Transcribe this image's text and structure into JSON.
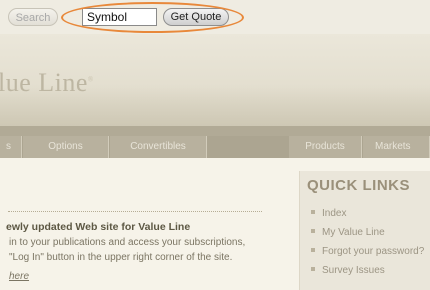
{
  "topbar": {
    "search_label": "Search",
    "symbol_value": "Symbol",
    "get_quote_label": "Get Quote"
  },
  "header": {
    "logo_text": "lue Line",
    "logo_mark": "®"
  },
  "tabs": {
    "first_label": "s",
    "options_label": "Options",
    "convertibles_label": "Convertibles",
    "products_label": "Products",
    "markets_label": "Markets"
  },
  "news": {
    "title": "ewly updated Web site for Value Line",
    "line1": "in to your publications and access your subscriptions,",
    "line2": "\"Log In\" button in the upper right corner of the site.",
    "link": "here"
  },
  "quick_links": {
    "title": "QUICK LINKS",
    "items": [
      "Index",
      "My Value Line",
      "Forgot your password?",
      "Survey Issues"
    ]
  },
  "colors": {
    "highlight_ring": "#e8883a",
    "nav_bar": "#b1aa96",
    "page_bg": "#f6f3e9"
  }
}
